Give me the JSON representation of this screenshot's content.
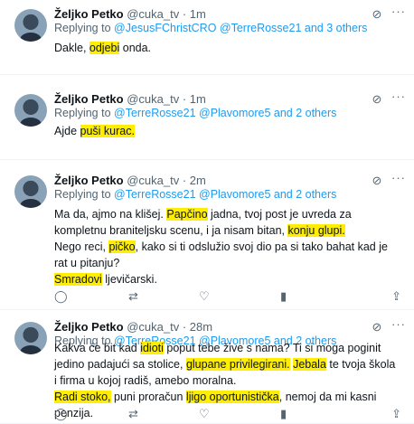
{
  "author": {
    "name": "Željko Petko",
    "handle": "@cuka_tv"
  },
  "icons": {
    "grok": "grok-icon",
    "more": "more-icon",
    "reply": "reply-icon",
    "retweet": "retweet-icon",
    "like": "heart-icon",
    "share": "share-icon"
  },
  "highlight_color": "#ffee00",
  "tweets": [
    {
      "time": "1m",
      "replying_prefix": "Replying to",
      "replying_links": "@JesusFChristCRO @TerreRosse21 and 3 others",
      "body": {
        "t1": "Dakle, ",
        "h1": "odjebi",
        "t2": " onda."
      }
    },
    {
      "time": "1m",
      "replying_prefix": "Replying to",
      "replying_links": "@TerreRosse21 @Plavomore5 and 2 others",
      "body": {
        "t1": "Ajde ",
        "h1": "puši kurac."
      }
    },
    {
      "time": "2m",
      "replying_prefix": "Replying to",
      "replying_links": "@TerreRosse21 @Plavomore5 and 2 others",
      "body": {
        "t1": "Ma da, ajmo na klišej. ",
        "h1": "Papčino",
        "t2": " jadna, tvoj post je uvreda za kompletnu branitelјsku scenu, i ja nisam bitan, ",
        "h2": "konju glupi.",
        "t3": "Nego reci, ",
        "h3": "pičko",
        "t4": ", kako si ti odslužio svoj dio pa si tako bahat kad je rat u pitanju?",
        "h4": "Smradovi",
        "t5": " ljevičarski."
      }
    },
    {
      "time": "28m",
      "replying_prefix": "Replying to",
      "replying_links": "@TerreRosse21 @Plavomore5 and 2 others",
      "body": {
        "t1": "Kakva će bit kad ",
        "h1": "idioti",
        "t2": " poput tebe žive s nama? Ti si moga poginit jedino padajući sa stolice, ",
        "h2": "glupane privilegirani.",
        "t3": " ",
        "h3": "Jebala",
        "t4": " te tvoja škola i firma u kojoj radiš, amebo moralna.",
        "h4": "Radi stoko,",
        "t5": " puni proračun ",
        "h5": "ljigo oportunistička",
        "t6": ", nemoj da mi kasni penzija."
      }
    }
  ]
}
